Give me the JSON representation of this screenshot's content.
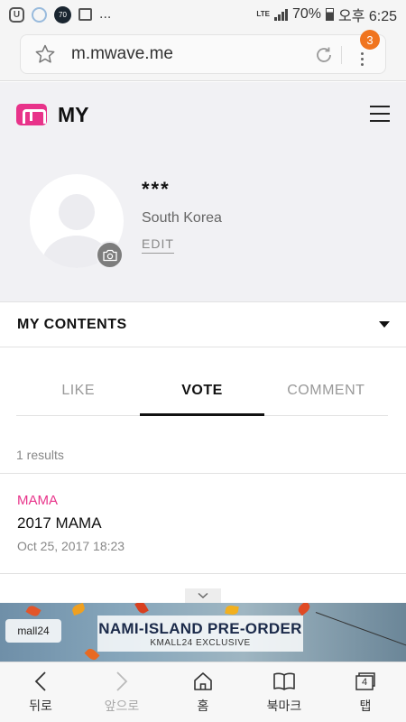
{
  "status_bar": {
    "left_icons": [
      "u-app-icon",
      "wifi-icon",
      "circle-70-icon",
      "image-icon"
    ],
    "circle_number": "70",
    "more": "...",
    "network": "LTE",
    "battery": "70%",
    "time": "오후 6:25"
  },
  "browser": {
    "url": "m.mwave.me",
    "tab_badge": "3"
  },
  "header": {
    "title": "MY"
  },
  "profile": {
    "name": "***",
    "country": "South Korea",
    "edit_label": "EDIT"
  },
  "my_contents": {
    "title": "MY CONTENTS"
  },
  "tabs": [
    {
      "label": "LIKE",
      "active": false
    },
    {
      "label": "VOTE",
      "active": true
    },
    {
      "label": "COMMENT",
      "active": false
    }
  ],
  "results": "1 results",
  "items": [
    {
      "category": "MAMA",
      "title": "2017 MAMA",
      "date": "Oct 25, 2017 18:23"
    }
  ],
  "banner": {
    "logo_text": "mall24",
    "title": "NAMI-ISLAND PRE-ORDER",
    "subtitle": "KMALL24 EXCLUSIVE"
  },
  "bottom_nav": [
    {
      "label": "뒤로",
      "icon": "back-icon",
      "disabled": false
    },
    {
      "label": "앞으로",
      "icon": "forward-icon",
      "disabled": true
    },
    {
      "label": "홈",
      "icon": "home-icon",
      "disabled": false
    },
    {
      "label": "북마크",
      "icon": "bookmark-icon",
      "disabled": false
    },
    {
      "label": "탭",
      "icon": "tabs-icon",
      "disabled": false,
      "count": "4"
    }
  ],
  "colors": {
    "accent": "#e8338a",
    "badge": "#f0741e",
    "header_bg": "#f1f1f4"
  }
}
